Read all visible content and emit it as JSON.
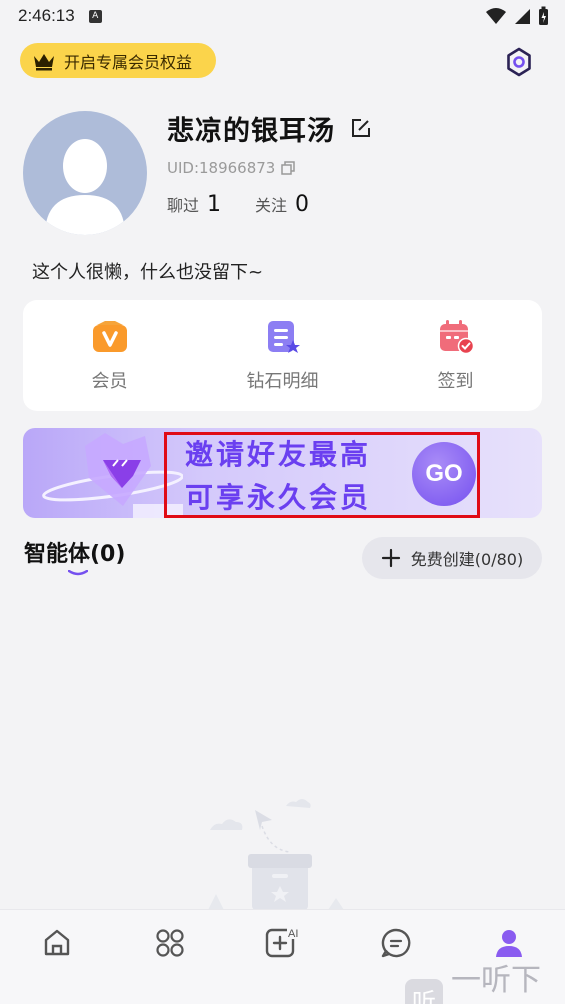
{
  "status_bar": {
    "time": "2:46:13",
    "badge": "A"
  },
  "header": {
    "vip_label": "开启专属会员权益"
  },
  "profile": {
    "name": "悲凉的银耳汤",
    "uid": "UID:18966873",
    "chatted_label": "聊过",
    "chatted_count": "1",
    "following_label": "关注",
    "following_count": "0",
    "bio": "这个人很懒，什么也没留下~"
  },
  "quick_actions": [
    {
      "label": "会员",
      "icon": "vip-icon"
    },
    {
      "label": "钻石明细",
      "icon": "diamond-details-icon"
    },
    {
      "label": "签到",
      "icon": "checkin-calendar-icon"
    }
  ],
  "banner": {
    "line1": "邀请好友最高",
    "line2": "可享永久会员",
    "go": "GO"
  },
  "agents": {
    "title": "智能体(0)",
    "create_label": "免费创建(0/80)"
  },
  "tabbar": [
    {
      "name": "home-icon"
    },
    {
      "name": "apps-grid-icon"
    },
    {
      "name": "ai-create-icon"
    },
    {
      "name": "message-icon"
    },
    {
      "name": "profile-icon"
    }
  ],
  "watermark": {
    "logo": "听",
    "text": "一听下载"
  },
  "colors": {
    "accent": "#7550ef",
    "vip_yellow": "#fbd44b",
    "highlight_red": "#e00b16"
  }
}
